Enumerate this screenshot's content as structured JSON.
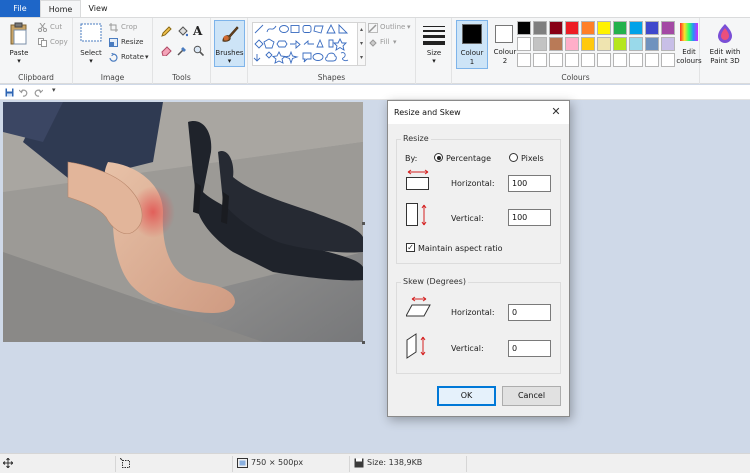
{
  "tabs": {
    "file": "File",
    "home": "Home",
    "view": "View"
  },
  "clipboard": {
    "paste": "Paste",
    "cut": "Cut",
    "copy": "Copy",
    "label": "Clipboard"
  },
  "image": {
    "select": "Select",
    "crop": "Crop",
    "resize": "Resize",
    "rotate": "Rotate",
    "label": "Image"
  },
  "tools": {
    "label": "Tools"
  },
  "brushes": {
    "label": "Brushes"
  },
  "shapes": {
    "outline": "Outline",
    "fill": "Fill",
    "label": "Shapes"
  },
  "size": {
    "label": "Size"
  },
  "colours": {
    "colour1": "Colour",
    "colour1_num": "1",
    "colour2": "Colour",
    "colour2_num": "2",
    "edit": "Edit",
    "edit2": "colours",
    "label": "Colours",
    "row1": [
      "#000000",
      "#7f7f7f",
      "#880015",
      "#ed1c24",
      "#ff7f27",
      "#fff200",
      "#22b14c",
      "#00a2e8",
      "#3f48cc",
      "#a349a4"
    ],
    "row2": [
      "#ffffff",
      "#c3c3c3",
      "#b97a57",
      "#ffaec9",
      "#ffc90e",
      "#efe4b0",
      "#b5e61d",
      "#99d9ea",
      "#7092be",
      "#c8bfe7"
    ]
  },
  "paint3d": {
    "line1": "Edit with",
    "line2": "Paint 3D"
  },
  "status": {
    "dimensions": "750 × 500px",
    "size": "Size: 138,9KB"
  },
  "dialog": {
    "title": "Resize and Skew",
    "resize_legend": "Resize",
    "by": "By:",
    "percentage": "Percentage",
    "pixels": "Pixels",
    "horizontal": "Horizontal:",
    "vertical": "Vertical:",
    "resize_h": "100",
    "resize_v": "100",
    "maintain": "Maintain aspect ratio",
    "skew_legend": "Skew (Degrees)",
    "skew_h": "0",
    "skew_v": "0",
    "ok": "OK",
    "cancel": "Cancel"
  }
}
